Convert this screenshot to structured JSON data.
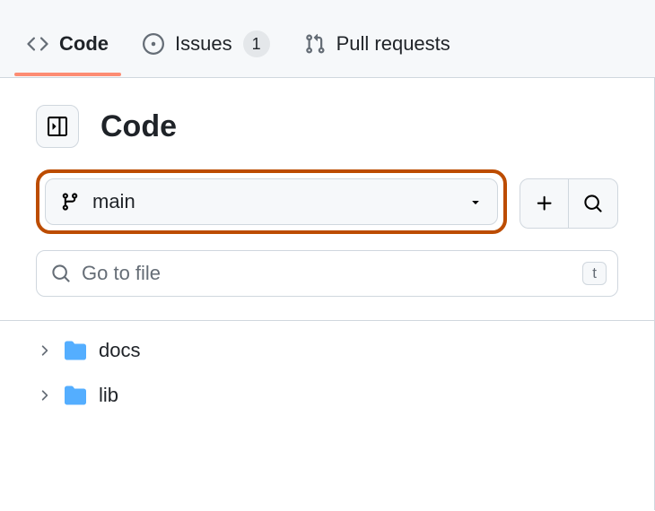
{
  "tabs": {
    "code": "Code",
    "issues": "Issues",
    "issues_count": "1",
    "pulls": "Pull requests"
  },
  "header": {
    "title": "Code"
  },
  "branch": {
    "name": "main"
  },
  "search": {
    "placeholder": "Go to file",
    "shortcut": "t"
  },
  "files": [
    {
      "name": "docs"
    },
    {
      "name": "lib"
    }
  ]
}
